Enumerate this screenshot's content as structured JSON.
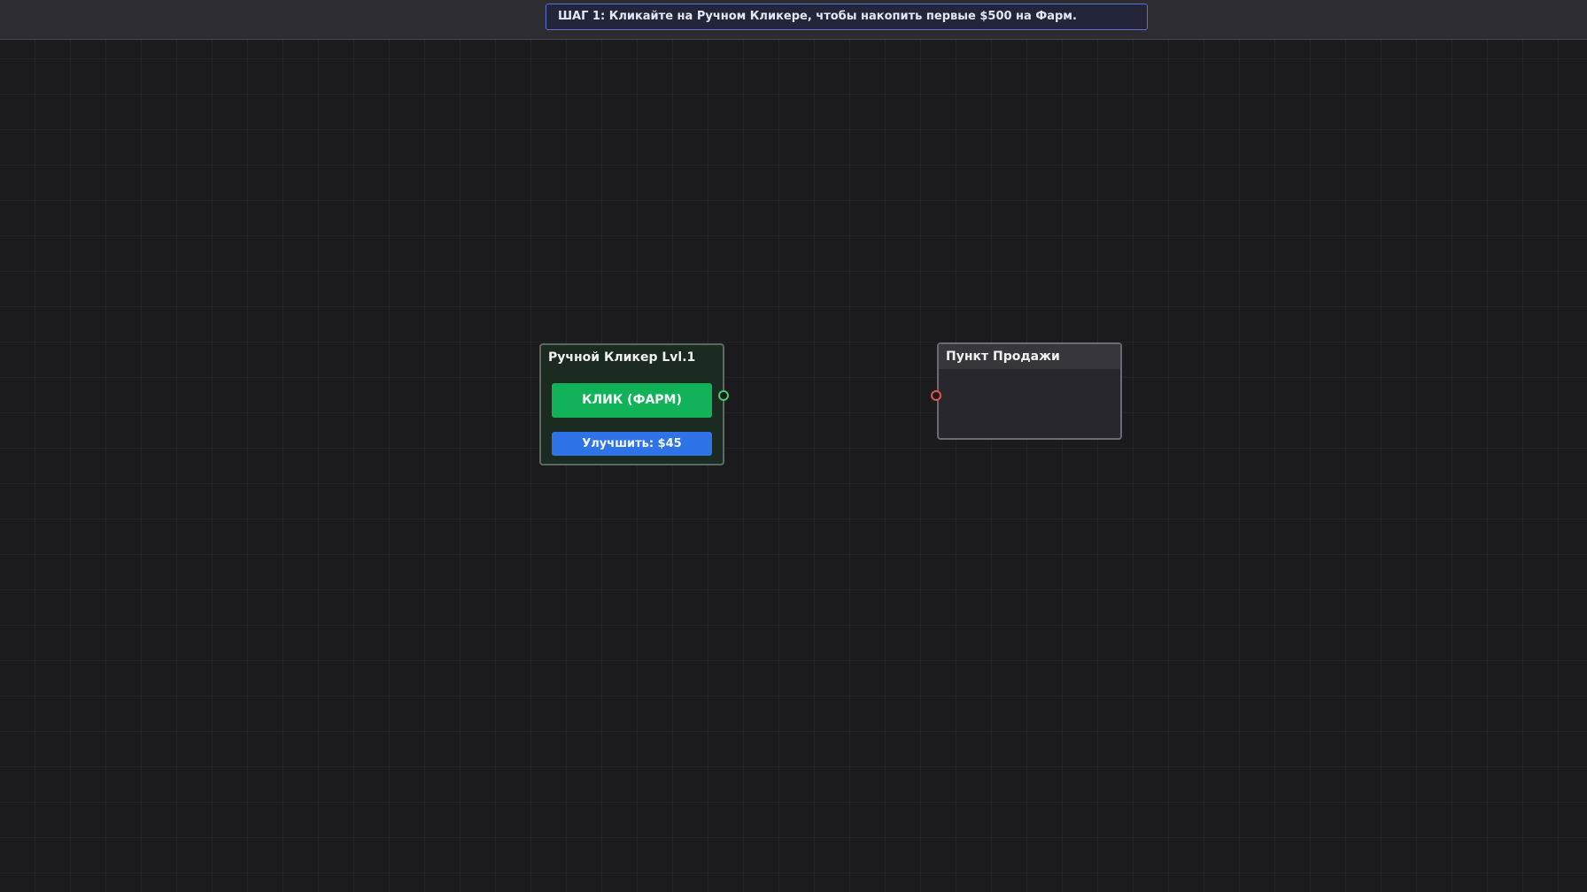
{
  "tutorial": {
    "text": "ШАГ 1: Кликайте на Ручном Кликере, чтобы накопить первые $500 на Фарм."
  },
  "nodes": {
    "clicker": {
      "title": "Ручной Кликер Lvl.1",
      "farm_button": "КЛИК (ФАРМ)",
      "upgrade_button": "Улучшить: $45",
      "output_port_color": "#3fcf6d"
    },
    "sell_point": {
      "title": "Пункт Продажи",
      "input_port_color": "#e2554f"
    }
  },
  "colors": {
    "background": "#1b1b1e",
    "farm_button": "#11b258",
    "upgrade_button": "#2f73e8",
    "tutorial_border": "#5b6fd6"
  }
}
